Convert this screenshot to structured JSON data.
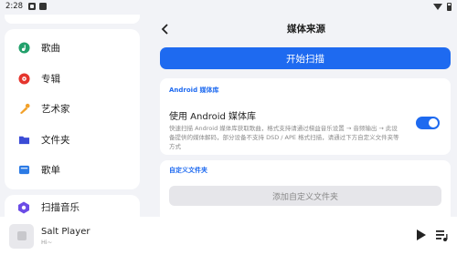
{
  "status_bar": {
    "time": "2:28"
  },
  "sidebar": {
    "items": [
      {
        "label": "歌曲",
        "icon": "song-icon",
        "color": "#22a06b"
      },
      {
        "label": "专辑",
        "icon": "album-icon",
        "color": "#e5352d"
      },
      {
        "label": "艺术家",
        "icon": "artist-icon",
        "color": "#f2a12a"
      },
      {
        "label": "文件夹",
        "icon": "folder-icon",
        "color": "#3b4cd6"
      },
      {
        "label": "歌单",
        "icon": "playlist-icon",
        "color": "#2c7be5"
      }
    ],
    "scan_label": "扫描音乐"
  },
  "header": {
    "title": "媒体来源"
  },
  "scan_button": {
    "label": "开始扫描"
  },
  "android_section": {
    "label": "Android 媒体库",
    "option_title": "使用 Android 媒体库",
    "option_desc": "快速扫描 Android 媒体库获取歌曲，格式支持请通过梯益音乐设置 → 音频输出 → 此设备提供的媒体解码，部分设备不支持 DSD / APE 格式扫描，请通过下方自定义文件夹等方式",
    "toggle_on": true
  },
  "custom_section": {
    "label": "自定义文件夹",
    "add_label": "添加自定义文件夹"
  },
  "player": {
    "title": "Salt Player",
    "subtitle": "Hi~"
  },
  "colors": {
    "accent": "#1e6af0",
    "background": "#f2f3f7"
  }
}
